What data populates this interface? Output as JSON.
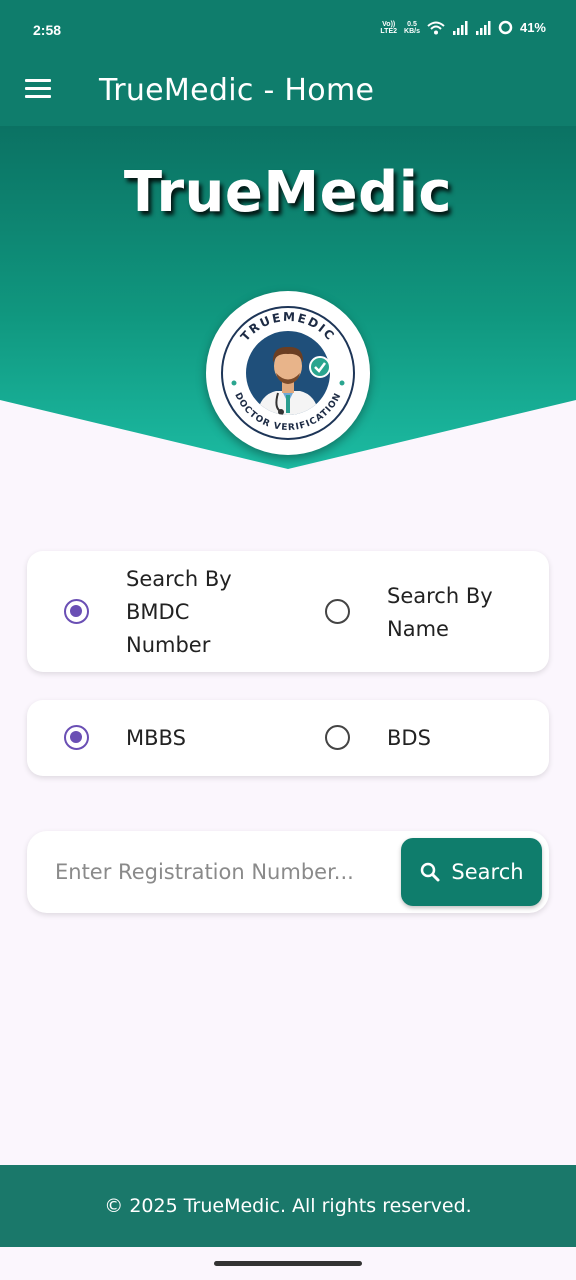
{
  "status_bar": {
    "time": "2:58",
    "volte": "Vo))\nLTE2",
    "speed": "0.5\nKB/s",
    "battery": "41%"
  },
  "app_bar": {
    "title": "TrueMedic - Home"
  },
  "hero": {
    "title": "TrueMedic",
    "logo_top_text": "TRUEMEDIC",
    "logo_bottom_text": "DOCTOR VERIFICATION"
  },
  "search_type": {
    "options": [
      {
        "label": "Search By BMDC Number",
        "selected": true
      },
      {
        "label": "Search By Name",
        "selected": false
      }
    ]
  },
  "degree": {
    "options": [
      {
        "label": "MBBS",
        "selected": true
      },
      {
        "label": "BDS",
        "selected": false
      }
    ]
  },
  "search": {
    "placeholder": "Enter Registration Number...",
    "button_label": "Search"
  },
  "footer": {
    "text": "© 2025 TrueMedic. All rights reserved."
  },
  "colors": {
    "primary": "#0f7d6c",
    "accent_radio": "#6a4fb4",
    "background": "#fbf6fd"
  }
}
